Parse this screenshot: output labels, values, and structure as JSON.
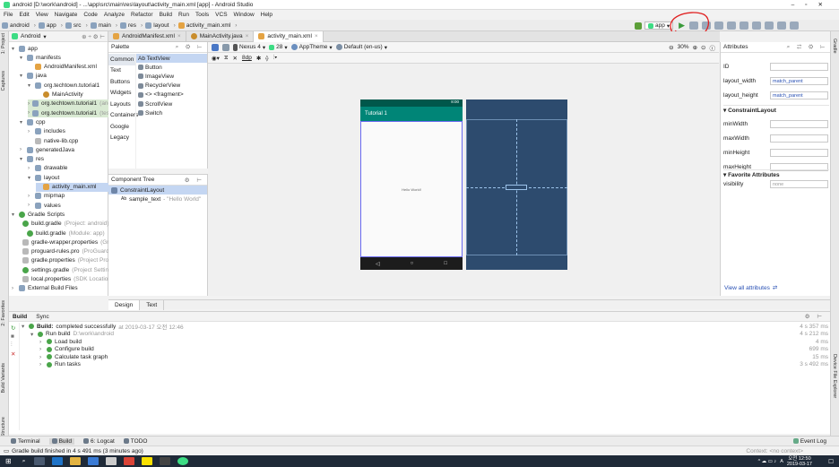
{
  "window": {
    "title": "android [D:\\work\\android] - ...\\app\\src\\main\\res\\layout\\activity_main.xml [app] - Android Studio"
  },
  "menu": [
    "File",
    "Edit",
    "View",
    "Navigate",
    "Code",
    "Analyze",
    "Refactor",
    "Build",
    "Run",
    "Tools",
    "VCS",
    "Window",
    "Help"
  ],
  "breadcrumbs": [
    "android",
    "app",
    "src",
    "main",
    "res",
    "layout",
    "activity_main.xml"
  ],
  "run_config": "app",
  "project": {
    "view_selector": "Android",
    "tree": [
      {
        "label": "app",
        "indent": 0,
        "icon": "fold",
        "arrow": "▾"
      },
      {
        "label": "manifests",
        "indent": 1,
        "icon": "fold",
        "arrow": "▾"
      },
      {
        "label": "AndroidManifest.xml",
        "indent": 2,
        "icon": "xml",
        "arrow": ""
      },
      {
        "label": "java",
        "indent": 1,
        "icon": "fold",
        "arrow": "▾"
      },
      {
        "label": "org.techtown.tutorial1",
        "indent": 2,
        "icon": "fold",
        "arrow": "▾"
      },
      {
        "label": "MainActivity",
        "indent": 3,
        "icon": "java",
        "arrow": ""
      },
      {
        "label": "org.techtown.tutorial1",
        "suffix": "(and",
        "indent": 2,
        "icon": "fold",
        "arrow": "›",
        "tint": "#d9ead3"
      },
      {
        "label": "org.techtown.tutorial1",
        "suffix": "(test",
        "indent": 2,
        "icon": "fold",
        "arrow": "›",
        "tint": "#d9ead3"
      },
      {
        "label": "cpp",
        "indent": 1,
        "icon": "fold",
        "arrow": "▾"
      },
      {
        "label": "includes",
        "indent": 2,
        "icon": "fold",
        "arrow": "›"
      },
      {
        "label": "native-lib.cpp",
        "indent": 2,
        "icon": "file",
        "arrow": ""
      },
      {
        "label": "generatedJava",
        "indent": 1,
        "icon": "fold",
        "arrow": "›"
      },
      {
        "label": "res",
        "indent": 1,
        "icon": "fold",
        "arrow": "▾"
      },
      {
        "label": "drawable",
        "indent": 2,
        "icon": "fold",
        "arrow": "›"
      },
      {
        "label": "layout",
        "indent": 2,
        "icon": "fold",
        "arrow": "▾"
      },
      {
        "label": "activity_main.xml",
        "indent": 3,
        "icon": "xml",
        "arrow": "",
        "selected": true
      },
      {
        "label": "mipmap",
        "indent": 2,
        "icon": "fold",
        "arrow": "›"
      },
      {
        "label": "values",
        "indent": 2,
        "icon": "fold",
        "arrow": "›"
      },
      {
        "label": "Gradle Scripts",
        "indent": 0,
        "icon": "grad",
        "arrow": "▾"
      },
      {
        "label": "build.gradle",
        "suffix": "(Project: android)",
        "indent": 1,
        "icon": "grad",
        "arrow": ""
      },
      {
        "label": "build.gradle",
        "suffix": "(Module: app)",
        "indent": 1,
        "icon": "grad",
        "arrow": ""
      },
      {
        "label": "gradle-wrapper.properties",
        "suffix": "(Grad",
        "indent": 1,
        "icon": "file",
        "arrow": ""
      },
      {
        "label": "proguard-rules.pro",
        "suffix": "(ProGuard R",
        "indent": 1,
        "icon": "file",
        "arrow": ""
      },
      {
        "label": "gradle.properties",
        "suffix": "(Project Prope",
        "indent": 1,
        "icon": "file",
        "arrow": ""
      },
      {
        "label": "settings.gradle",
        "suffix": "(Project Settin",
        "indent": 1,
        "icon": "grad",
        "arrow": ""
      },
      {
        "label": "local.properties",
        "suffix": "(SDK Location)",
        "indent": 1,
        "icon": "file",
        "arrow": ""
      },
      {
        "label": "External Build Files",
        "indent": 0,
        "icon": "fold",
        "arrow": "›"
      }
    ]
  },
  "editor_tabs": [
    {
      "label": "AndroidManifest.xml",
      "active": false
    },
    {
      "label": "MainActivity.java",
      "active": false
    },
    {
      "label": "activity_main.xml",
      "active": true
    }
  ],
  "palette": {
    "title": "Palette",
    "categories": [
      "Common",
      "Text",
      "Buttons",
      "Widgets",
      "Layouts",
      "Containers",
      "Google",
      "Legacy"
    ],
    "items": [
      "Ab TextView",
      "Button",
      "ImageView",
      "RecyclerView",
      "<> <fragment>",
      "ScrollView",
      "Switch"
    ]
  },
  "component_tree": {
    "title": "Component Tree",
    "root": "ConstraintLayout",
    "child_id": "sample_text",
    "child_text": "- \"Hello World\""
  },
  "design_toolbar": {
    "device": "Nexus 4",
    "api": "28",
    "theme": "AppTheme",
    "locale": "Default (en-us)",
    "zoom": "30%",
    "margin": "8dp"
  },
  "phone": {
    "app_title": "Tutorial 1",
    "center_text": "Hello World!",
    "time": "8:00"
  },
  "attributes": {
    "title": "Attributes",
    "id_label": "ID",
    "id_value": "",
    "layout_width": {
      "label": "layout_width",
      "value": "match_parent"
    },
    "layout_height": {
      "label": "layout_height",
      "value": "match_parent"
    },
    "constraint_header": "ConstraintLayout",
    "constraint_fields": [
      "minWidth",
      "maxWidth",
      "minHeight",
      "maxHeight"
    ],
    "fav_header": "Favorite Attributes",
    "visibility_label": "visibility",
    "visibility_value": "none",
    "view_all": "View all attributes"
  },
  "design_tabs": [
    "Design",
    "Text"
  ],
  "build": {
    "tabs": [
      "Build",
      "Sync"
    ],
    "lines": [
      {
        "indent": 0,
        "text": "Build:",
        "rest": " completed successfully",
        "extra": "at 2019-03-17 오전 12:46",
        "time": "4 s 357 ms"
      },
      {
        "indent": 1,
        "text": "Run build",
        "rest": "",
        "extra": "D:\\work\\android",
        "time": "4 s 212 ms"
      },
      {
        "indent": 2,
        "text": "Load build",
        "rest": "",
        "extra": "",
        "time": "4 ms"
      },
      {
        "indent": 2,
        "text": "Configure build",
        "rest": "",
        "extra": "",
        "time": "699 ms"
      },
      {
        "indent": 2,
        "text": "Calculate task graph",
        "rest": "",
        "extra": "",
        "time": "15 ms"
      },
      {
        "indent": 2,
        "text": "Run tasks",
        "rest": "",
        "extra": "",
        "time": "3 s 492 ms"
      }
    ]
  },
  "tool_tabs": [
    "Terminal",
    "Build",
    "6: Logcat",
    "TODO"
  ],
  "event_log": "Event Log",
  "status": {
    "message": "Gradle build finished in 4 s 491 ms (3 minutes ago)",
    "context": "Context: <no context>"
  },
  "sidebar_left": [
    "1: Project",
    "Captures",
    "2: Favorites",
    "Build Variants",
    "Z: Structure"
  ],
  "sidebar_right": [
    "Gradle",
    "Device File Explorer"
  ],
  "taskbar": {
    "time": "오전 12:50",
    "date": "2019-03-17",
    "lang": "A"
  },
  "colors": {
    "accent": "#008577",
    "blueprint": "#2d4b6e",
    "selection": "#c4d6f2"
  }
}
